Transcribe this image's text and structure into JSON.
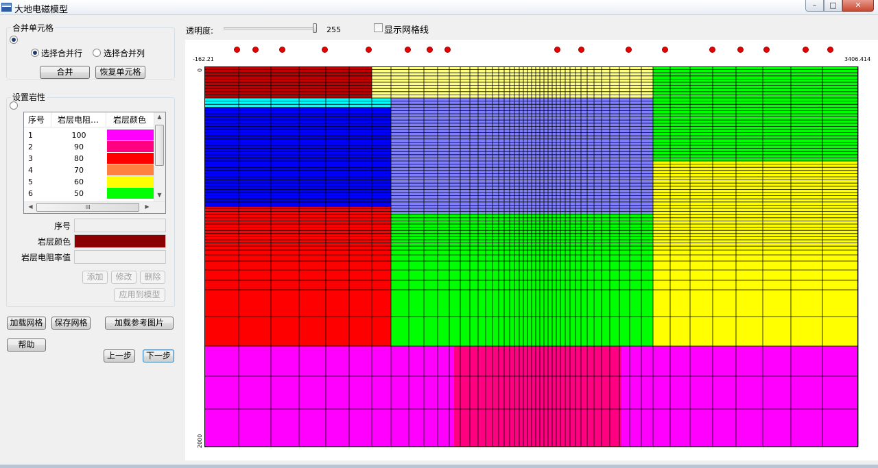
{
  "window": {
    "title": "大地电磁模型",
    "controls": {
      "minimize": "–",
      "maximize": "□",
      "close": "✕"
    }
  },
  "merge_cells": {
    "title": "合并单元格",
    "option_row": "选择合并行",
    "option_col": "选择合并列",
    "merge_button": "合并",
    "restore_button": "恢复单元格"
  },
  "lithology": {
    "title": "设置岩性",
    "columns": [
      "序号",
      "岩层电阻…",
      "岩层颜色"
    ],
    "rows": [
      {
        "id": "1",
        "resistivity": "100",
        "color": "#ff00ff"
      },
      {
        "id": "2",
        "resistivity": "90",
        "color": "#ff0080"
      },
      {
        "id": "3",
        "resistivity": "80",
        "color": "#ff0000"
      },
      {
        "id": "4",
        "resistivity": "70",
        "color": "#ff8040"
      },
      {
        "id": "5",
        "resistivity": "60",
        "color": "#ffff00"
      },
      {
        "id": "6",
        "resistivity": "50",
        "color": "#00ff00"
      }
    ],
    "hscroll_grip": "III",
    "field_id_label": "序号",
    "field_color_label": "岩层颜色",
    "field_color_value": "#8b0000",
    "field_res_label": "岩层电阻率值",
    "add_button": "添加",
    "modify_button": "修改",
    "delete_button": "删除",
    "apply_button": "应用到模型"
  },
  "actions": {
    "load_grid": "加载网格",
    "save_grid": "保存网格",
    "load_ref_image": "加载参考图片",
    "help": "帮助",
    "prev": "上一步",
    "next": "下一步"
  },
  "toolbar": {
    "transparency_label": "透明度:",
    "transparency_value": "255",
    "show_grid_label": "显示网格线",
    "show_grid_checked": false
  },
  "model": {
    "x_min_label": "-162.21",
    "x_max_label": "3406.414",
    "depth_top_label": "0",
    "depth_bottom_label": "2000",
    "station_count": 16
  },
  "colors": {
    "dark_red": "#c00000",
    "light_yellow": "#ffff80",
    "cyan": "#00ffff",
    "blue": "#0000ff",
    "periwinkle": "#8080ff",
    "red": "#ff0000",
    "green": "#00ff00",
    "yellow": "#ffff00",
    "magenta": "#ff00ff",
    "rose": "#ff0080",
    "station": "#e60000"
  }
}
